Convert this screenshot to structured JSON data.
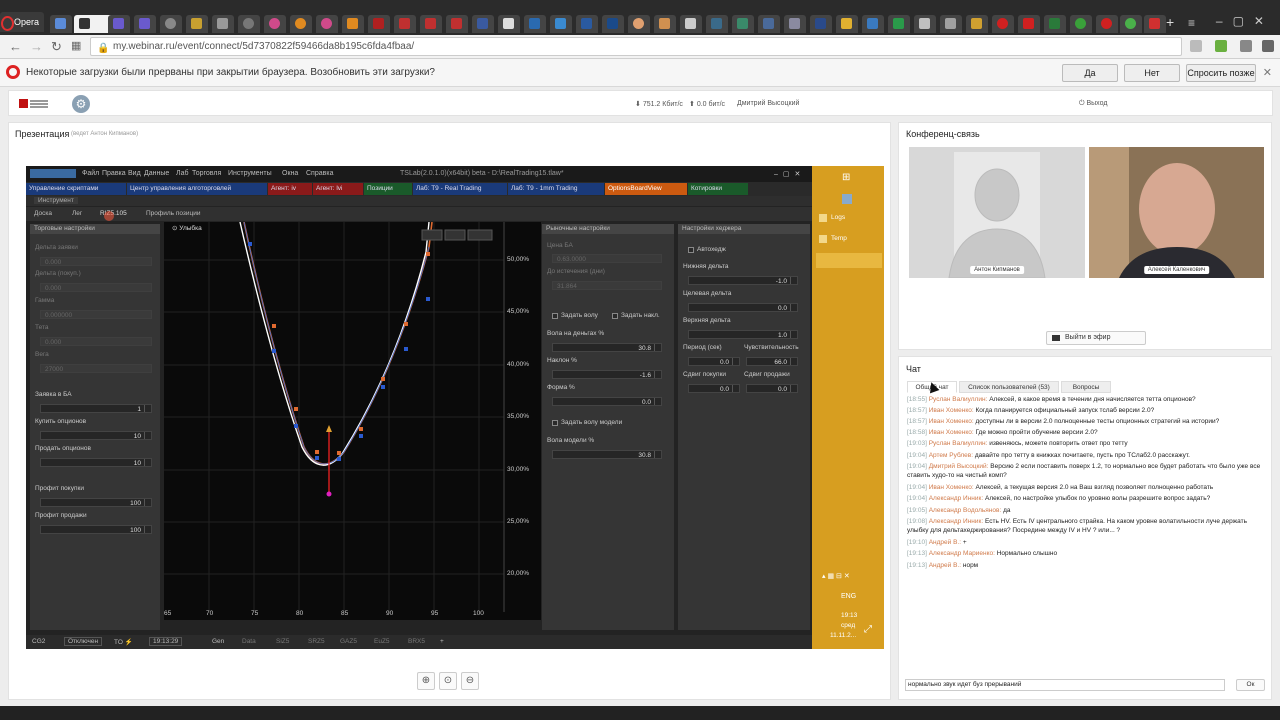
{
  "browser": {
    "menu_label": "Opera",
    "url": "my.webinar.ru/event/connect/5d7370822f59466da8b195c6fda4fbaa/",
    "download_bar": {
      "message": "Некоторые загрузки были прерваны при закрытии браузера. Возобновить эти загрузки?",
      "yes": "Да",
      "no": "Нет",
      "later": "Спросить позже"
    }
  },
  "webinar_header": {
    "download_speed": "751.2 Кбит/с",
    "upload_speed": "0.0 бит/с",
    "user": "Дмитрий Высоцкий",
    "logout": "Выход"
  },
  "presentation": {
    "title": "Презентация",
    "presenter": "(ведет Антон Кипманов)"
  },
  "app": {
    "menu": [
      "Файл",
      "Правка",
      "Вид",
      "Данные",
      "Лаб",
      "Торговля",
      "Инструменты",
      "Окна",
      "Справка"
    ],
    "window_title": "TSLab(2.0.1.0)(x64bit) beta - D:\\RealTrading15.tlaw*",
    "tabs": [
      {
        "label": "Управление скриптами",
        "color": "#1a3a7a"
      },
      {
        "label": "Центр управления алготорговлей",
        "color": "#1a3a7a"
      },
      {
        "label": "Агент: iv",
        "color": "#8a1a1a"
      },
      {
        "label": "Агент: lvi",
        "color": "#8a1a1a"
      },
      {
        "label": "Позиции",
        "color": "#1a5a2a"
      },
      {
        "label": "Лаб: Т9 - Real Trading",
        "color": "#1a3a7a"
      },
      {
        "label": "Лаб: Т9 - 1mm Trading",
        "color": "#1a3a7a"
      },
      {
        "label": "OptionsBoardView",
        "color": "#cc5a10"
      },
      {
        "label": "Котировки",
        "color": "#1a5a2a"
      }
    ],
    "toolbar_label": "Инструмент",
    "subtabs": [
      "Доска",
      "Лег",
      "RIZ5.105",
      "Профиль позиции"
    ],
    "trade_panel": {
      "title": "Торговые настройки",
      "rows": [
        {
          "label": "Дельта заявки",
          "value": "0.000",
          "dim": true
        },
        {
          "label": "Дельта (покуп.)",
          "value": "0.000",
          "dim": true
        },
        {
          "label": "Гамма",
          "value": "0.000000",
          "dim": true
        },
        {
          "label": "Тета",
          "value": "0.000",
          "dim": true
        },
        {
          "label": "Вега",
          "value": "27000",
          "dim": true
        },
        {
          "label": "Заявка в БА",
          "value": "1",
          "dim": false
        },
        {
          "label": "Купить опционов",
          "value": "10",
          "dim": false
        },
        {
          "label": "Продать опционов",
          "value": "10",
          "dim": false
        },
        {
          "label": "Профит покупки",
          "value": "100",
          "dim": false
        },
        {
          "label": "Профит продажи",
          "value": "100",
          "dim": false
        }
      ]
    },
    "chart": {
      "title": "Улыбка",
      "y_ticks": [
        "50,00%",
        "45,00%",
        "40,00%",
        "35,00%",
        "30,00%",
        "25,00%",
        "20,00%"
      ],
      "x_ticks": [
        "65",
        "70",
        "75",
        "80",
        "85",
        "90",
        "95",
        "100"
      ]
    },
    "market_panel": {
      "title": "Рыночные настройки",
      "dim_labels": [
        "Цена БА",
        "До истечения (дни)"
      ],
      "dim_values": [
        "0.63.0000",
        "31.864"
      ],
      "check1": "Задать волу",
      "check2": "Задать накл.",
      "vol_label": "Вола на деньгах %",
      "vol_value": "30.8",
      "slope_label": "Наклон %",
      "slope_value": "-1.6",
      "shape_label": "Форма %",
      "shape_value": "0.0",
      "model_check": "Задать волу модели",
      "model_label": "Вола модели %",
      "model_value": "30.8"
    },
    "hedge_panel": {
      "title": "Настройки хеджера",
      "auto": "Автохедж",
      "lower_label": "Нижняя дельта",
      "lower_value": "-1.0",
      "target_label": "Целевая дельта",
      "target_value": "0.0",
      "upper_label": "Верхняя дельта",
      "upper_value": "1.0",
      "period_label": "Период (сек)",
      "period_value": "0.0",
      "sens_label": "Чувствительность",
      "sens_value": "66.0",
      "shift_buy_label": "Сдвиг покупки",
      "shift_buy_value": "0.0",
      "shift_sell_label": "Сдвиг продажи",
      "shift_sell_value": "0.0"
    },
    "status": [
      "CG2",
      "Отключен",
      "TO ⚡",
      "19:13:29",
      "Gen",
      "Data",
      "SiZ5",
      "SRZ5",
      "GAZ5",
      "EuZ5",
      "BRX5"
    ]
  },
  "sidebar": {
    "items": [
      "Logs",
      "Temp"
    ],
    "lang": "ENG",
    "time": "19:13",
    "day": "сред",
    "date": "11.11.2..."
  },
  "conference": {
    "title": "Конференц-связь",
    "video1_name": "Антон Кипманов",
    "video2_name": "Алексей Каленкович",
    "on_air": "Выйти в эфир"
  },
  "chat": {
    "title": "Чат",
    "tabs": [
      "Общий чат",
      "Список пользователей (53)",
      "Вопросы"
    ],
    "messages": [
      {
        "time": "[18:55]",
        "name": "Руслан Валиуллин:",
        "text": "Алексей, в какое время в течении дня начисляется тетта опционов?"
      },
      {
        "time": "[18:57]",
        "name": "Иван Хоменко:",
        "text": "Когда планируется официальный запуск тслаб версии 2.0?"
      },
      {
        "time": "[18:57]",
        "name": "Иван Хоменко:",
        "text": "доступны ли в версии 2.0 полноценные тесты опционных стратегий на истории?"
      },
      {
        "time": "[18:58]",
        "name": "Иван Хоменко:",
        "text": "Где можно пройти обучение версии 2.0?"
      },
      {
        "time": "[19:03]",
        "name": "Руслан Валиуллин:",
        "text": "извеняюсь, можете повторить ответ про тетту"
      },
      {
        "time": "[19:04]",
        "name": "Артем Рублев:",
        "text": "давайте про тетту в книжках почитаете, пусть про TСлаб2.0 расскажут."
      },
      {
        "time": "[19:04]",
        "name": "Дмитрий Высоцкий:",
        "text": "Версию 2 если поставить поверх 1.2, то нормально все будет работать что было уже все ставить худо-то на чистый комп?"
      },
      {
        "time": "[19:04]",
        "name": "Иван Хоменко:",
        "text": "Алексей, а текущая версия 2.0 на Ваш взгляд позволяет полноценно работать"
      },
      {
        "time": "[19:04]",
        "name": "Александр Инник:",
        "text": "Алексей, по настройке улыбок по уровню волы разрешите вопрос задать?"
      },
      {
        "time": "[19:05]",
        "name": "Александр Водольянов:",
        "text": "да"
      },
      {
        "time": "[19:08]",
        "name": "Александр Инник:",
        "text": "Есть HV. Есть IV центрального страйка. На каком уровне волатильности луче держать улыбку для дельтахеджирования? Посредине между IV и HV ? или... ?"
      },
      {
        "time": "[19:10]",
        "name": "Андрей В.:",
        "text": "+"
      },
      {
        "time": "[19:13]",
        "name": "Александр Мариенко:",
        "text": "Нормально слышно"
      },
      {
        "time": "[19:13]",
        "name": "Андрей В.:",
        "text": "норм"
      }
    ],
    "input_value": "нормально звук идет буз прерываний",
    "send": "Ок"
  }
}
